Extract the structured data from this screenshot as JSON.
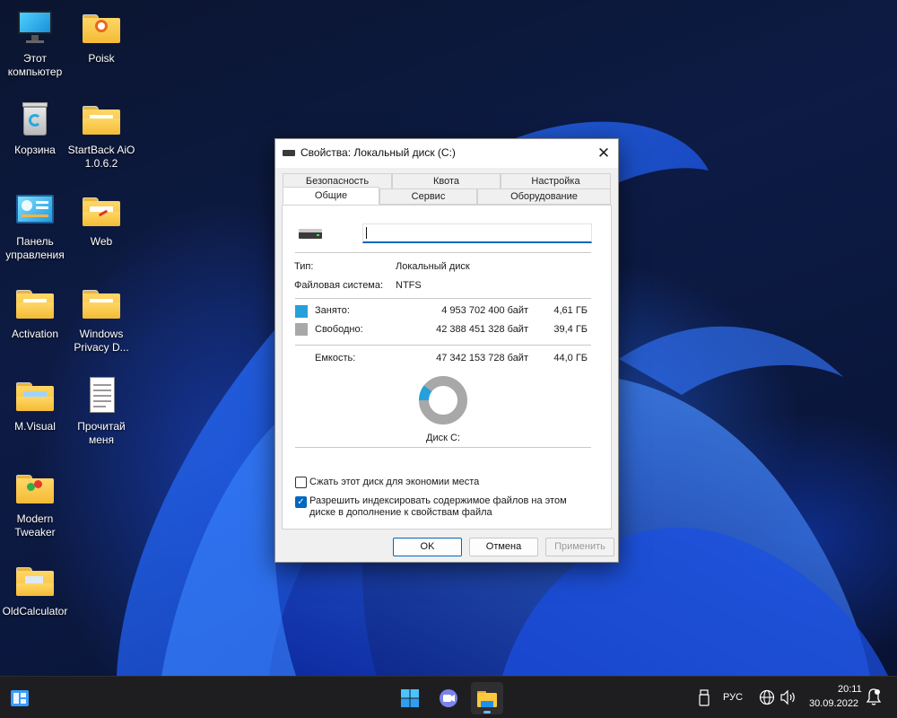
{
  "desktop": {
    "icons": [
      {
        "label": "Этот компьютер",
        "icon": "monitor-icon"
      },
      {
        "label": "Poisk",
        "icon": "folder-icon"
      },
      {
        "label": "Корзина",
        "icon": "recycle-bin-icon"
      },
      {
        "label": "StartBack AiO 1.0.6.2",
        "icon": "folder-icon"
      },
      {
        "label": "Панель управления",
        "icon": "control-panel-icon"
      },
      {
        "label": "Web",
        "icon": "folder-icon"
      },
      {
        "label": "Activation",
        "icon": "folder-icon"
      },
      {
        "label": "Windows Privacy D...",
        "icon": "folder-icon"
      },
      {
        "label": "M.Visual",
        "icon": "folder-icon"
      },
      {
        "label": "Прочитай меня",
        "icon": "text-file-icon"
      },
      {
        "label": "Modern Tweaker",
        "icon": "folder-icon"
      },
      {
        "label": "OldCalculator",
        "icon": "folder-icon"
      }
    ]
  },
  "dialog": {
    "title": "Свойства: Локальный диск (C:)",
    "close_icon": "close-icon",
    "tabs_row1": [
      "Безопасность",
      "Квота",
      "Настройка"
    ],
    "tabs_row2": [
      "Общие",
      "Сервис",
      "Оборудование"
    ],
    "active_tab": "Общие",
    "volume_label_value": "",
    "type_label": "Тип:",
    "type_value": "Локальный диск",
    "fs_label": "Файловая система:",
    "fs_value": "NTFS",
    "used": {
      "label": "Занято:",
      "bytes": "4 953 702 400 байт",
      "size": "4,61 ГБ",
      "color": "#26a0da"
    },
    "free": {
      "label": "Свободно:",
      "bytes": "42 388 451 328 байт",
      "size": "39,4 ГБ",
      "color": "#a8a8a8"
    },
    "capacity": {
      "label": "Емкость:",
      "bytes": "47 342 153 728 байт",
      "size": "44,0 ГБ"
    },
    "used_fraction": 0.1046,
    "disk_label": "Диск C:",
    "compress_label": "Сжать этот диск для экономии места",
    "compress_checked": false,
    "index_label_line1": "Разрешить индексировать содержимое файлов на этом",
    "index_label_line2": "диске в дополнение к свойствам файла",
    "index_checked": true,
    "ok": "OK",
    "cancel": "Отмена",
    "apply": "Применить"
  },
  "taskbar": {
    "left_icon": "widgets-icon",
    "center_icons": [
      "start-icon",
      "chat-icon",
      "file-explorer-icon"
    ],
    "language": "РУС",
    "time": "20:11",
    "date": "30.09.2022"
  }
}
